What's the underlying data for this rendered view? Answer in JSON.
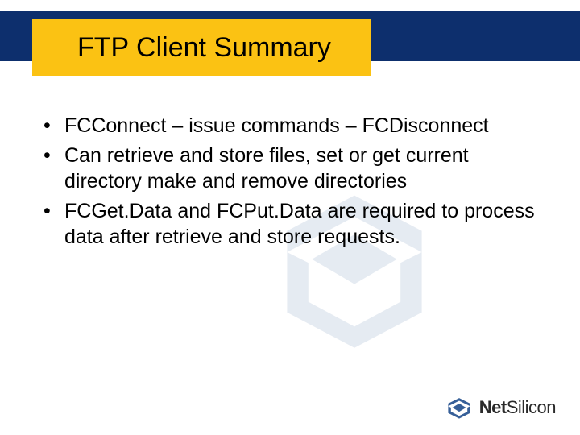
{
  "title": "FTP Client Summary",
  "bullets": [
    "FCConnect – issue commands – FCDisconnect",
    "Can retrieve and store files, set or get current directory make and remove directories",
    "FCGet.Data and FCPut.Data are required to process data after retrieve and store requests."
  ],
  "brand": {
    "name_bold": "Net",
    "name_light": "Silicon"
  },
  "colors": {
    "navy": "#0d2f6d",
    "yellow": "#fbc213",
    "logo": "#365f98"
  }
}
